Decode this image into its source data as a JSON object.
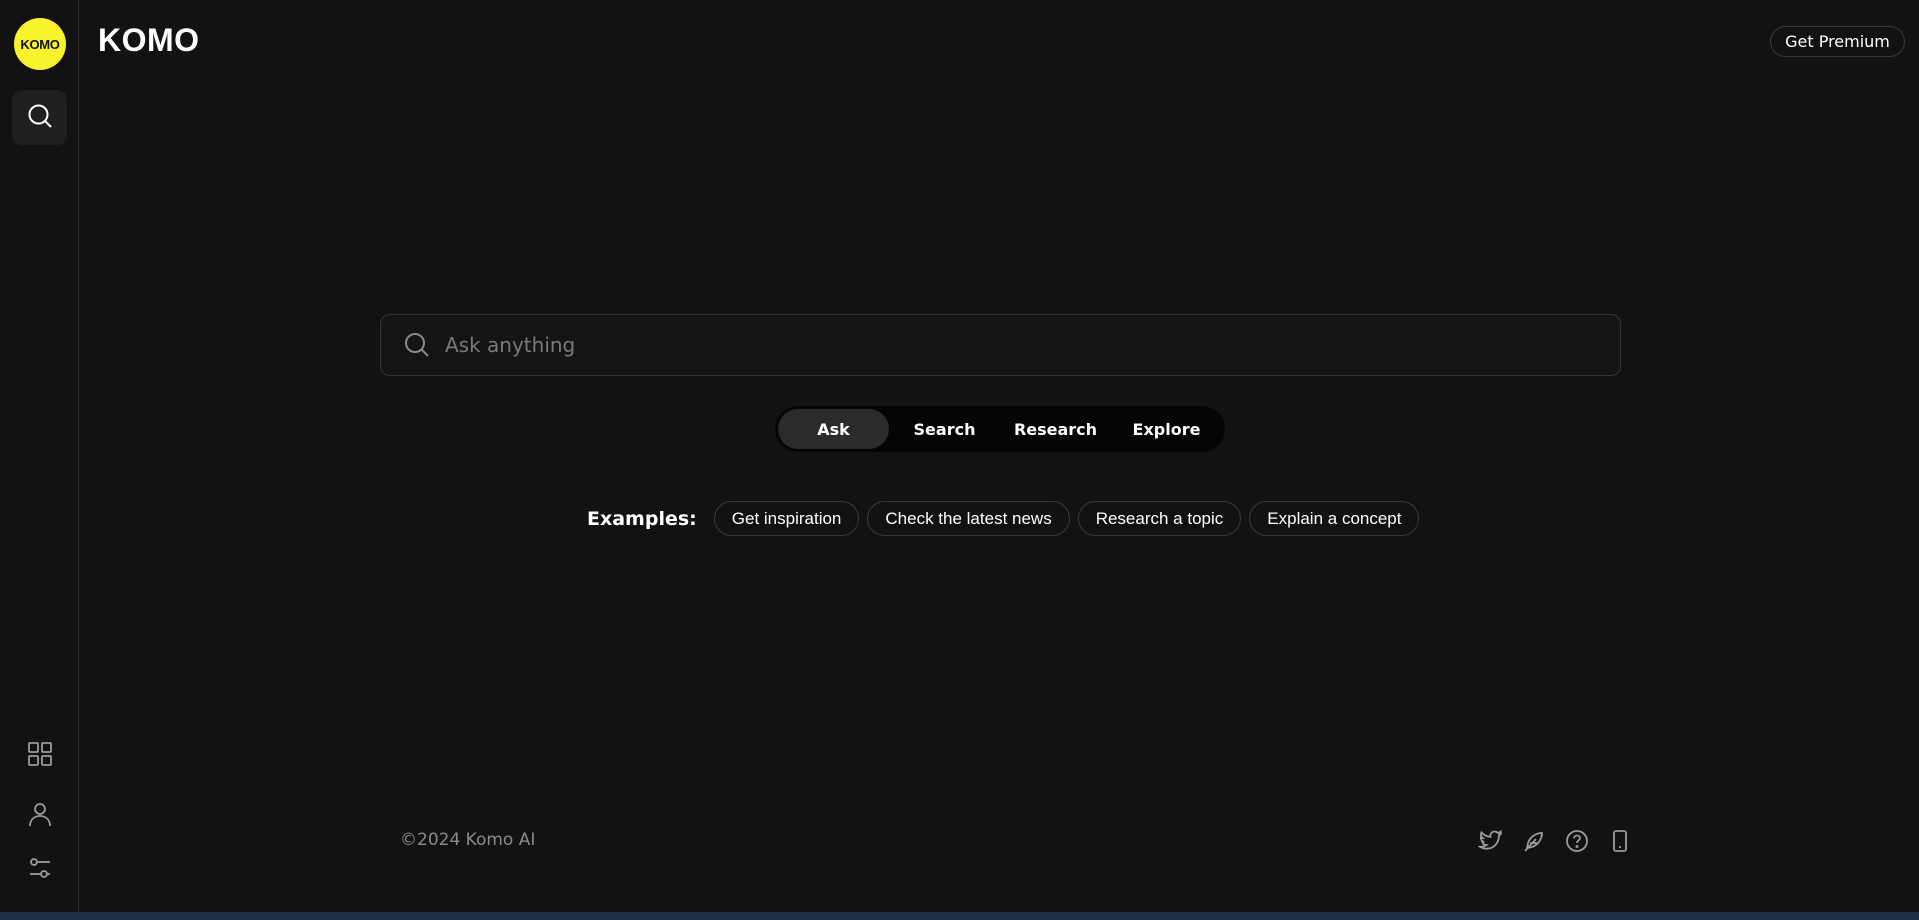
{
  "app": {
    "logo_text": "KOMO",
    "brand": "KOMO",
    "premium_label": "Get Premium"
  },
  "sidebar": {
    "items": [
      {
        "name": "search",
        "icon": "search-icon",
        "active": true
      },
      {
        "name": "apps",
        "icon": "grid-icon"
      },
      {
        "name": "profile",
        "icon": "user-icon"
      },
      {
        "name": "settings",
        "icon": "sliders-icon"
      }
    ]
  },
  "search": {
    "placeholder": "Ask anything",
    "value": ""
  },
  "modes": [
    {
      "label": "Ask",
      "active": true
    },
    {
      "label": "Search"
    },
    {
      "label": "Research"
    },
    {
      "label": "Explore"
    }
  ],
  "examples": {
    "label": "Examples:",
    "items": [
      "Get inspiration",
      "Check the latest news",
      "Research a topic",
      "Explain a concept"
    ]
  },
  "footer": {
    "copyright": "©2024 Komo AI",
    "icons": [
      "twitter-icon",
      "feather-icon",
      "help-icon",
      "mobile-icon"
    ]
  },
  "colors": {
    "background": "#121212",
    "logo": "#f8f32b",
    "active_tab": "#2b2b2b"
  }
}
